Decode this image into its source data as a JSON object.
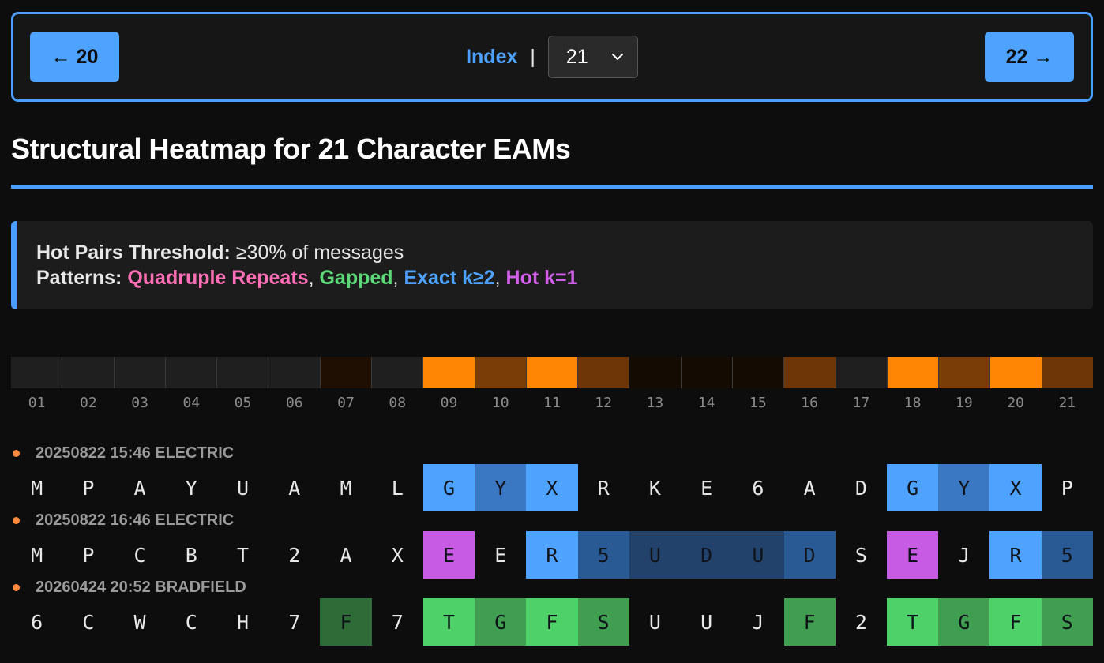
{
  "nav": {
    "prev_label": "← 20",
    "next_label": "22 →",
    "index_label": "Index",
    "separator": "|",
    "selected_value": "21"
  },
  "title": "Structural Heatmap for 21 Character EAMs",
  "info": {
    "threshold_label": "Hot Pairs Threshold:",
    "threshold_value": "≥30% of messages",
    "patterns_label": "Patterns:",
    "pattern_quad": "Quadruple Repeats",
    "pattern_gapped": "Gapped",
    "pattern_exact": "Exact k≥2",
    "pattern_hot": "Hot k=1",
    "comma": ","
  },
  "heatmap": {
    "positions": [
      "01",
      "02",
      "03",
      "04",
      "05",
      "06",
      "07",
      "08",
      "09",
      "10",
      "11",
      "12",
      "13",
      "14",
      "15",
      "16",
      "17",
      "18",
      "19",
      "20",
      "21"
    ],
    "colors": [
      "#1f1f1f",
      "#1f1f1f",
      "#1f1f1f",
      "#1f1f1f",
      "#1f1f1f",
      "#1f1f1f",
      "#1f0e02",
      "#1f1f1f",
      "#ff8505",
      "#7a3d07",
      "#ff8505",
      "#6e3606",
      "#140b02",
      "#140b02",
      "#140b02",
      "#6e3606",
      "#1f1f1f",
      "#ff8505",
      "#7a3d07",
      "#ff8505",
      "#6e3606"
    ]
  },
  "messages": [
    {
      "header": "20250822 15:46 ELECTRIC",
      "chars": [
        "M",
        "P",
        "A",
        "Y",
        "U",
        "A",
        "M",
        "L",
        "G",
        "Y",
        "X",
        "R",
        "K",
        "E",
        "6",
        "A",
        "D",
        "G",
        "Y",
        "X",
        "P"
      ],
      "styles": [
        "",
        "",
        "",
        "",
        "",
        "",
        "",
        "",
        "blue",
        "blue2",
        "blue",
        "",
        "",
        "",
        "",
        "",
        "",
        "blue",
        "blue2",
        "blue",
        ""
      ]
    },
    {
      "header": "20250822 16:46 ELECTRIC",
      "chars": [
        "M",
        "P",
        "C",
        "B",
        "T",
        "2",
        "A",
        "X",
        "E",
        "E",
        "R",
        "5",
        "U",
        "D",
        "U",
        "D",
        "S",
        "E",
        "J",
        "R",
        "5"
      ],
      "styles": [
        "",
        "",
        "",
        "",
        "",
        "",
        "",
        "",
        "purple",
        "",
        "blue",
        "blue3",
        "blue4",
        "blue4",
        "blue4",
        "blue3",
        "",
        "purple",
        "",
        "blue",
        "blue3"
      ]
    },
    {
      "header": "20260424 20:52 BRADFIELD",
      "chars": [
        "6",
        "C",
        "W",
        "C",
        "H",
        "7",
        "F",
        "7",
        "T",
        "G",
        "F",
        "S",
        "U",
        "U",
        "J",
        "F",
        "2",
        "T",
        "G",
        "F",
        "S"
      ],
      "styles": [
        "",
        "",
        "",
        "",
        "",
        "",
        "green3",
        "",
        "green",
        "green2",
        "green",
        "green2",
        "",
        "",
        "",
        "green2",
        "",
        "green",
        "green2",
        "green",
        "green2"
      ]
    }
  ]
}
